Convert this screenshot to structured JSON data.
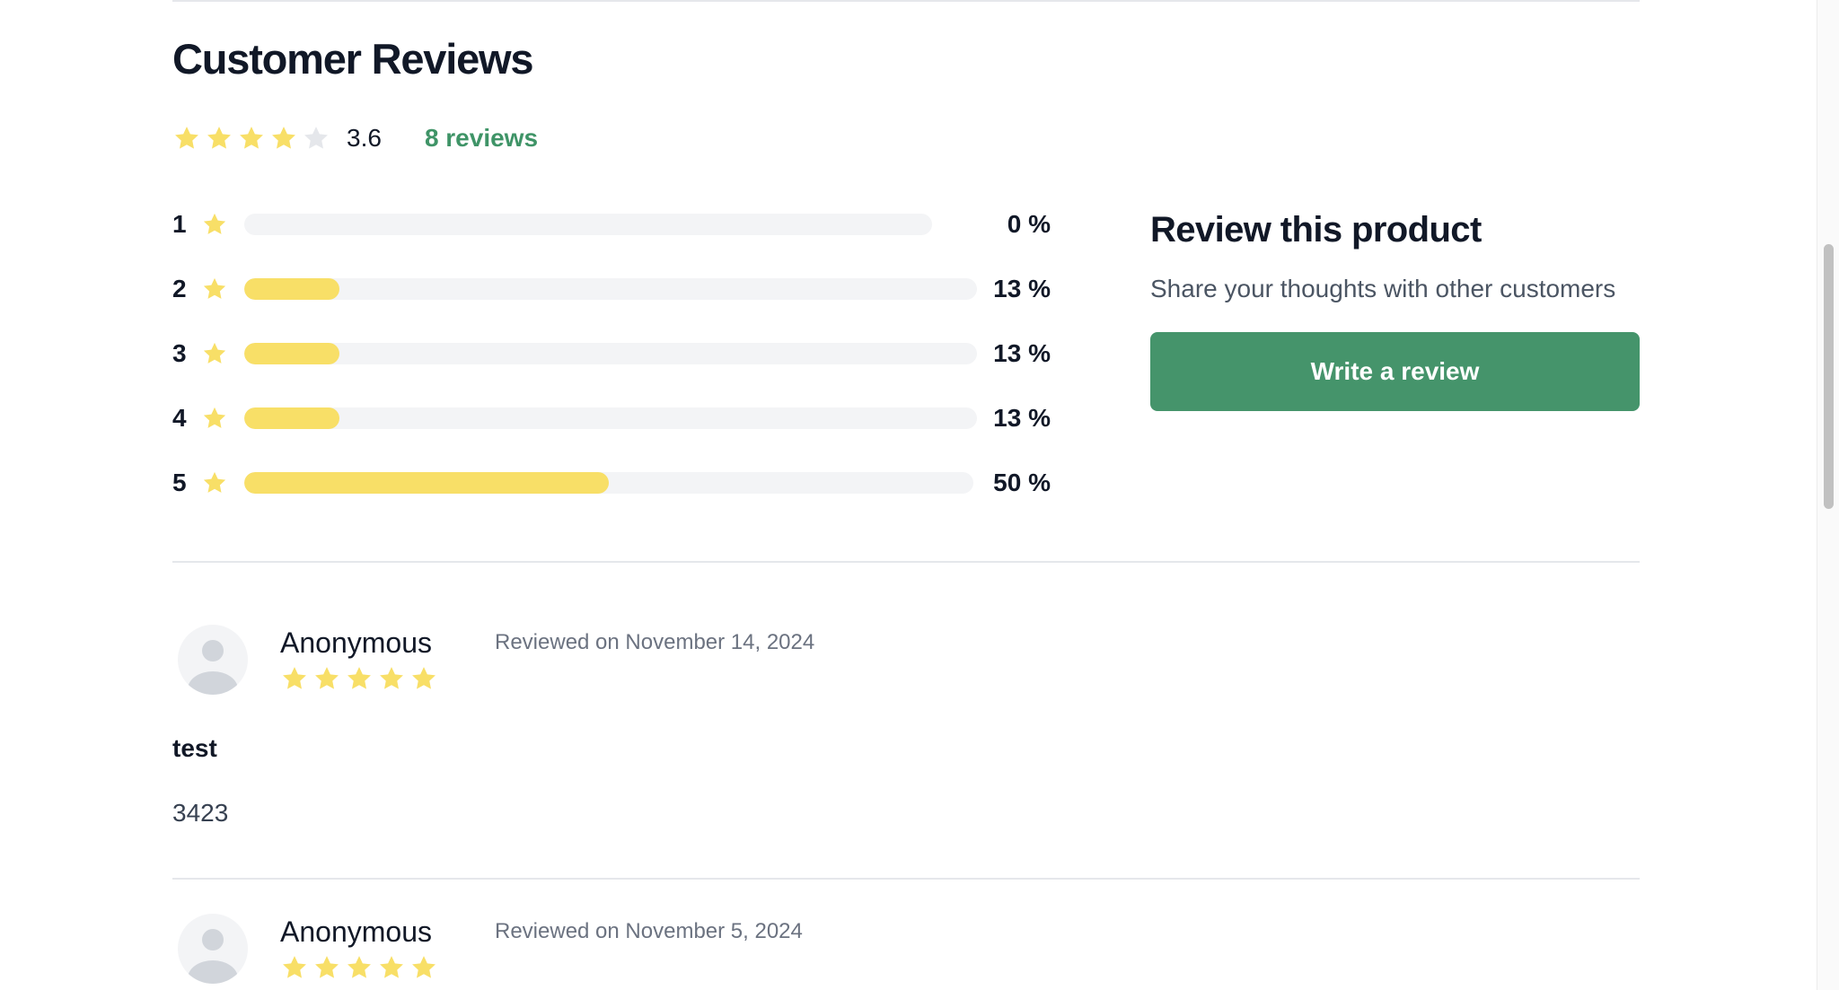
{
  "reviews_section": {
    "title": "Customer Reviews",
    "rating": {
      "average": "3.6",
      "stars_filled": 4,
      "stars_total": 5,
      "review_count_label": "8 reviews"
    },
    "distribution": [
      {
        "stars": "1",
        "percent": 0,
        "percent_label": "0 %"
      },
      {
        "stars": "2",
        "percent": 13,
        "percent_label": "13 %"
      },
      {
        "stars": "3",
        "percent": 13,
        "percent_label": "13 %"
      },
      {
        "stars": "4",
        "percent": 13,
        "percent_label": "13 %"
      },
      {
        "stars": "5",
        "percent": 50,
        "percent_label": "50 %"
      }
    ]
  },
  "cta": {
    "title": "Review this product",
    "subtitle": "Share your thoughts with other customers",
    "button_label": "Write a review"
  },
  "reviews": [
    {
      "author": "Anonymous",
      "date": "Reviewed on November 14, 2024",
      "stars": 5,
      "title": "test",
      "body": "3423"
    },
    {
      "author": "Anonymous",
      "date": "Reviewed on November 5, 2024",
      "stars": 5,
      "title": "",
      "body": ""
    }
  ],
  "colors": {
    "star_filled": "#f8df67",
    "star_empty": "#e5e7eb",
    "accent_green": "#45946b",
    "link_green": "#3f9467",
    "bar_track": "#f3f4f6"
  },
  "icons": {
    "star": "star-icon",
    "avatar": "user-avatar-icon"
  }
}
